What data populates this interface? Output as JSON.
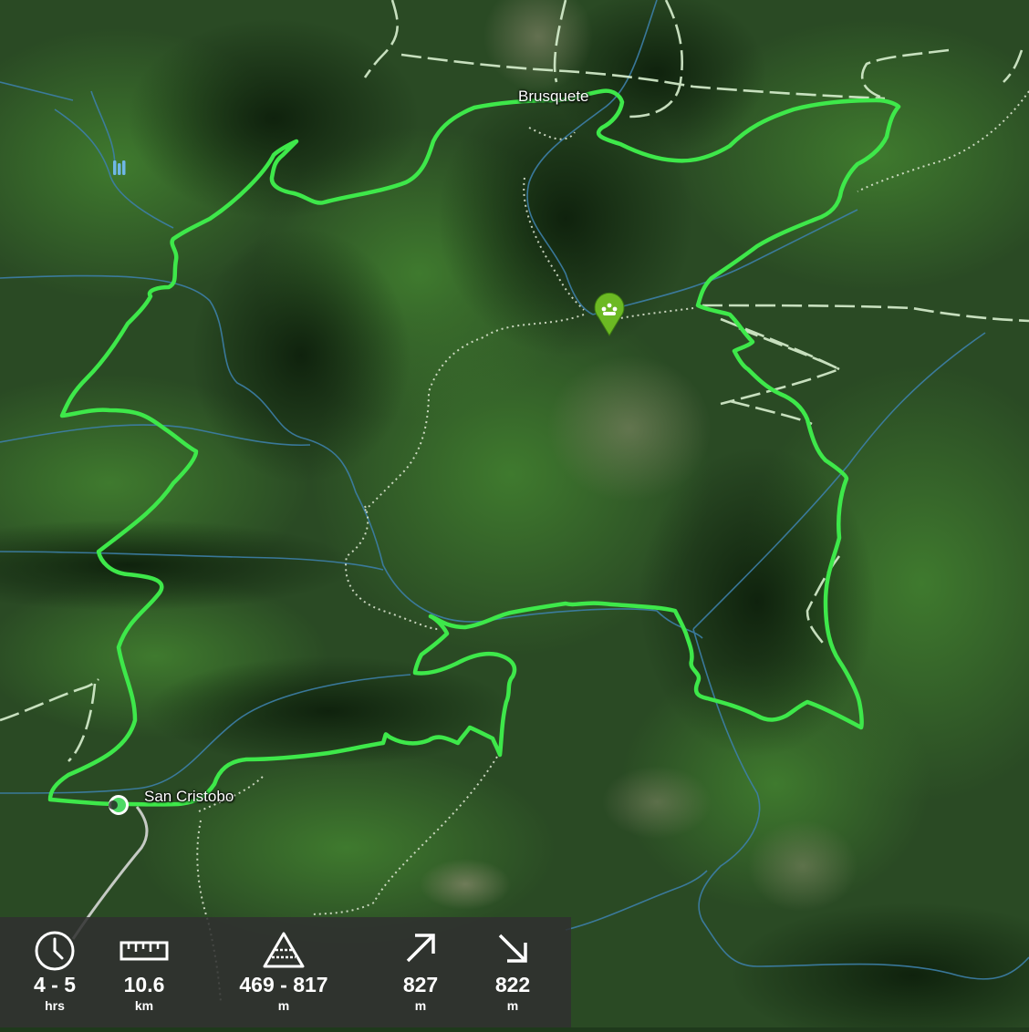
{
  "map": {
    "places": [
      {
        "name": "Brusquete"
      },
      {
        "name": "San Cristobo"
      }
    ],
    "poi_icon": "viewpoint-marker-icon",
    "start_icon": "start-point-icon",
    "water_icon": "waterfall-icon",
    "colors": {
      "route": "#3ee84a",
      "river": "#3d7fa8",
      "track": "#d8f0cf",
      "poi_marker": "#6cb923",
      "start_marker": "#4cd964"
    }
  },
  "stats": {
    "time": {
      "value": "4 - 5",
      "unit": "hrs",
      "icon": "clock-icon"
    },
    "distance": {
      "value": "10.6",
      "unit": "km",
      "icon": "ruler-icon"
    },
    "elevation": {
      "value": "469 - 817",
      "unit": "m",
      "icon": "elevation-icon"
    },
    "ascent": {
      "value": "827",
      "unit": "m",
      "icon": "arrow-up-right-icon"
    },
    "descent": {
      "value": "822",
      "unit": "m",
      "icon": "arrow-down-right-icon"
    }
  }
}
